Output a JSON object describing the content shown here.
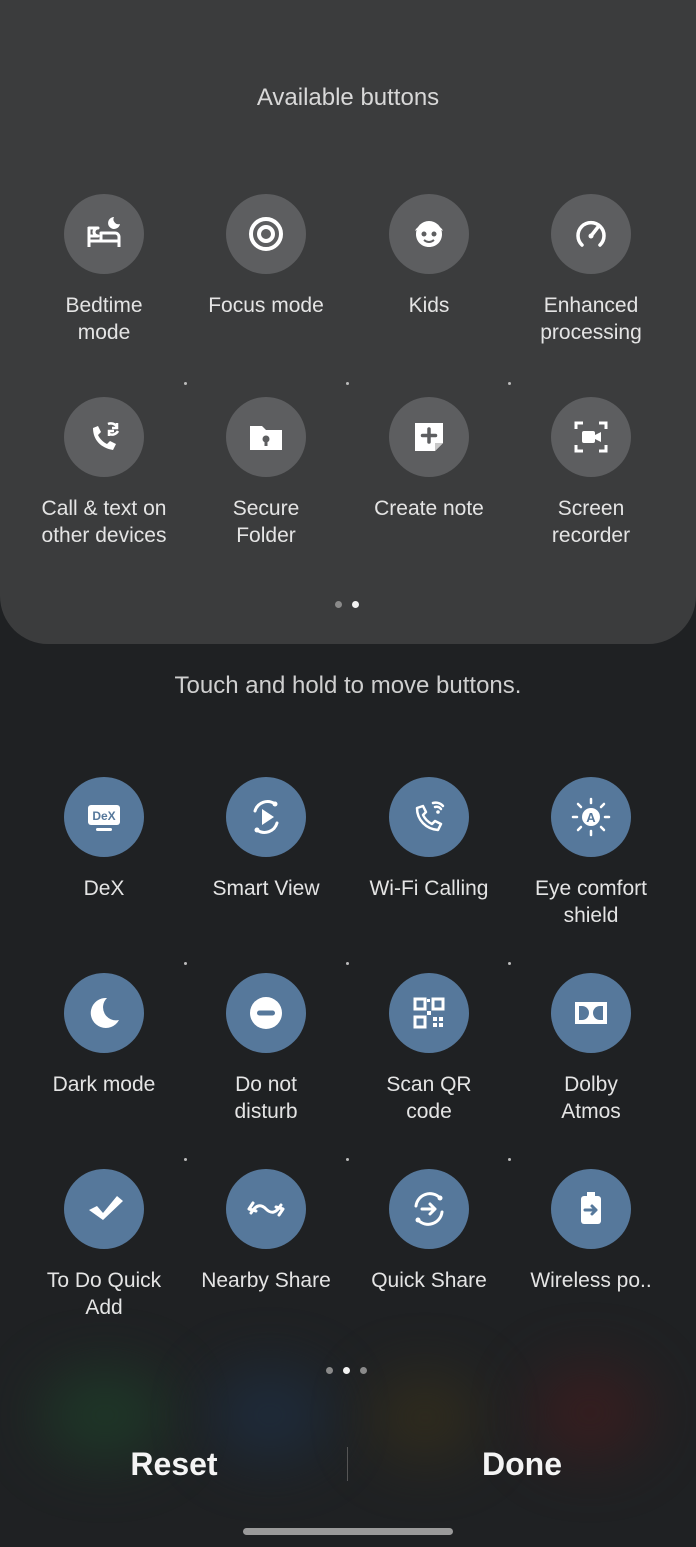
{
  "available": {
    "title": "Available buttons",
    "items": [
      {
        "label1": "Bedtime",
        "label2": "mode"
      },
      {
        "label1": "Focus mode",
        "label2": ""
      },
      {
        "label1": "Kids",
        "label2": ""
      },
      {
        "label1": "Enhanced",
        "label2": "processing"
      },
      {
        "label1": "Call & text on",
        "label2": "other devices"
      },
      {
        "label1": "Secure",
        "label2": "Folder"
      },
      {
        "label1": "Create note",
        "label2": ""
      },
      {
        "label1": "Screen",
        "label2": "recorder"
      }
    ],
    "page_indicator": {
      "pages": 2,
      "current": 2
    }
  },
  "hint": "Touch and hold to move buttons.",
  "active": {
    "items": [
      {
        "label1": "DeX",
        "label2": "",
        "icon_text": "DeX"
      },
      {
        "label1": "Smart View",
        "label2": ""
      },
      {
        "label1": "Wi-Fi Calling",
        "label2": ""
      },
      {
        "label1": "Eye comfort",
        "label2": "shield",
        "icon_text": "A"
      },
      {
        "label1": "Dark mode",
        "label2": ""
      },
      {
        "label1": "Do not",
        "label2": "disturb"
      },
      {
        "label1": "Scan QR",
        "label2": "code"
      },
      {
        "label1": "Dolby",
        "label2": "Atmos"
      },
      {
        "label1": "To Do Quick",
        "label2": "Add"
      },
      {
        "label1": "Nearby Share",
        "label2": ""
      },
      {
        "label1": "Quick Share",
        "label2": ""
      },
      {
        "label1": "Wireless po..",
        "label2": ""
      }
    ],
    "page_indicator": {
      "pages": 3,
      "current": 2
    }
  },
  "actions": {
    "reset": "Reset",
    "done": "Done"
  },
  "colors": {
    "panel": "#3b3c3d",
    "active_icon_bg": "#56789b",
    "inactive_icon_bg": "#5d5e60"
  }
}
